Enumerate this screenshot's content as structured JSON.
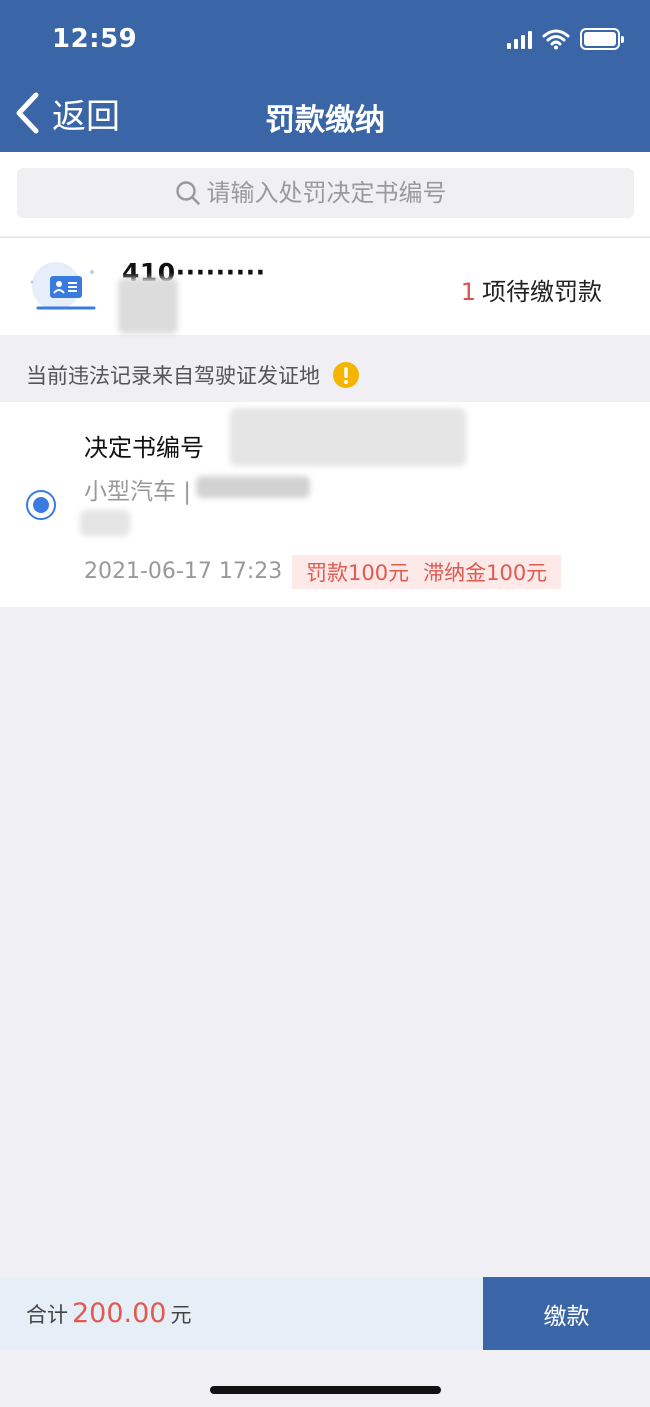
{
  "status_bar": {
    "time": "12:59"
  },
  "nav": {
    "back_label": "返回",
    "title": "罚款缴纳"
  },
  "search": {
    "placeholder": "请输入处罚决定书编号"
  },
  "license": {
    "number_masked": "410·········",
    "pending_count": "1",
    "pending_label": "项待缴罚款"
  },
  "notice": {
    "text": "当前违法记录来自驾驶证发证地"
  },
  "records": [
    {
      "label": "决定书编号",
      "vehicle_type": "小型汽车 |",
      "date": "2021-06-17 17:23",
      "fine": "罚款100元",
      "late_fee": "滞纳金100元"
    }
  ],
  "footer": {
    "total_label": "合计",
    "total_amount": "200.00",
    "currency": "元",
    "pay_label": "缴款"
  },
  "colors": {
    "header": "#3a66a8",
    "accent_red": "#e05a50",
    "radio_blue": "#3a7be0",
    "warning": "#f5b400"
  }
}
